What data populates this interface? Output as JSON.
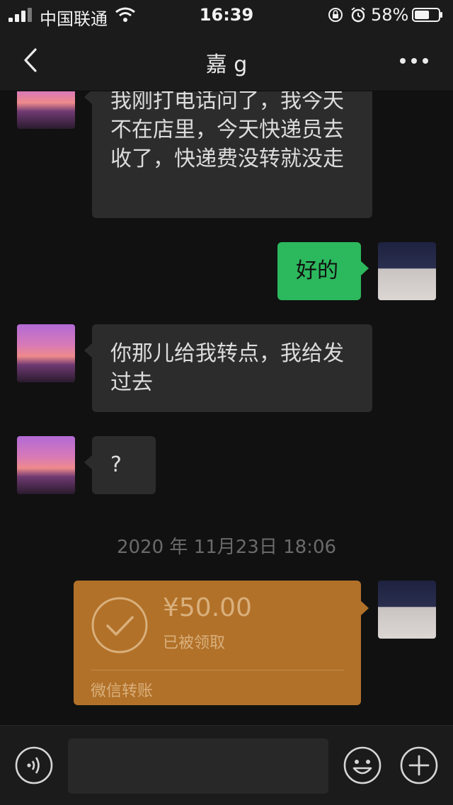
{
  "status_bar": {
    "carrier": "中国联通",
    "time": "16:39",
    "battery_percent": "58%"
  },
  "header": {
    "title": "嘉 g",
    "back_icon": "chevron-left-icon",
    "more_icon": "more-dots-icon"
  },
  "messages": [
    {
      "side": "left",
      "text": "我刚打电话问了，我今天不在店里，今天快递员去收了，快递费没转就没走"
    },
    {
      "side": "right",
      "text": "好的"
    },
    {
      "side": "left",
      "text": "你那儿给我转点，我给发过去"
    },
    {
      "side": "left",
      "text": "?"
    }
  ],
  "timestamp": "2020 年 11月23日 18:06",
  "transfer": {
    "amount": "¥50.00",
    "status": "已被领取",
    "footer": "微信转账",
    "color": "#b27129"
  },
  "toolbar": {
    "voice_icon": "voice-icon",
    "emoji_icon": "emoji-icon",
    "plus_icon": "plus-icon",
    "input_value": ""
  }
}
